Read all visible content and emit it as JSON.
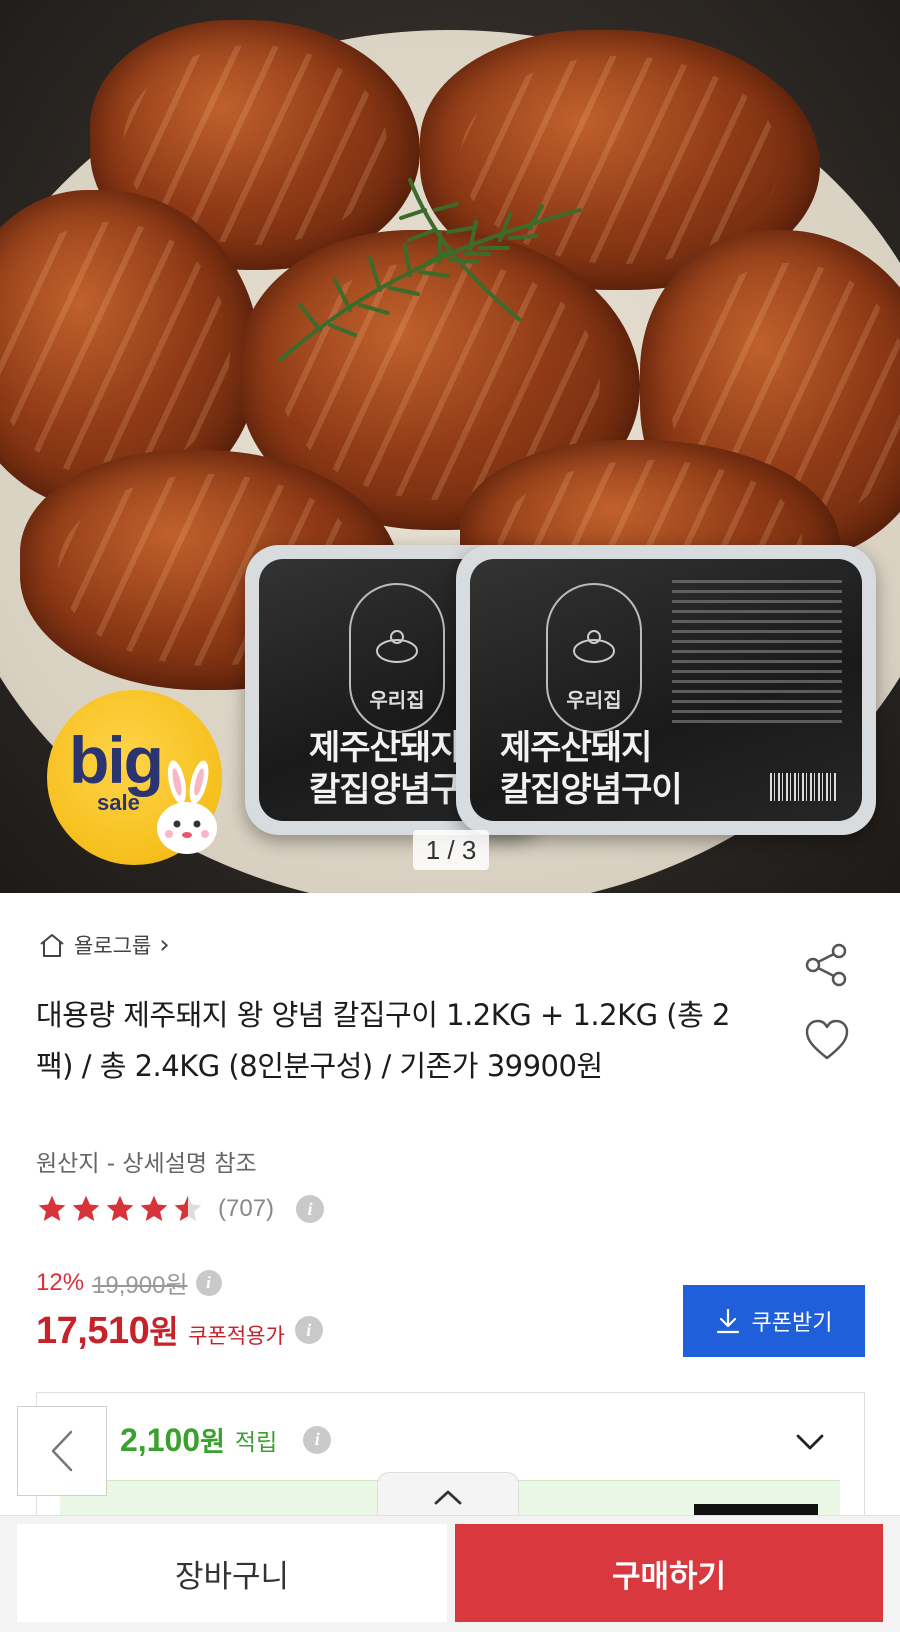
{
  "hero": {
    "pager": "1 / 3",
    "badge_big": "big",
    "badge_sale": "sale",
    "pack_brand": "우리집",
    "pack_title_line1": "제주산돼지",
    "pack_title_line2": "칼집양념구이"
  },
  "seller": {
    "name": "욜로그룹",
    "icon": "home-icon",
    "chevron": "›"
  },
  "product": {
    "title": "대용량 제주돼지 왕 양념 칼집구이 1.2KG + 1.2KG (총 2팩) / 총 2.4KG (8인분구성) / 기존가 39900원",
    "origin": "원산지 - 상세설명 참조",
    "rating": 4.5,
    "rating_count": "(707)"
  },
  "price": {
    "discount": "12%",
    "original": "19,900원",
    "final_number": "17,510",
    "final_unit": "원",
    "coupon_label": "쿠폰적용가",
    "coupon_button": "쿠폰받기"
  },
  "points": {
    "amount": "2,100",
    "unit": "원",
    "label": "적립"
  },
  "actions": {
    "cart": "장바구니",
    "buy": "구매하기"
  },
  "colors": {
    "accent_red": "#c5222a",
    "buy_red": "#d8383e",
    "coupon_blue": "#1f5fd9",
    "points_green": "#3aa02e"
  }
}
